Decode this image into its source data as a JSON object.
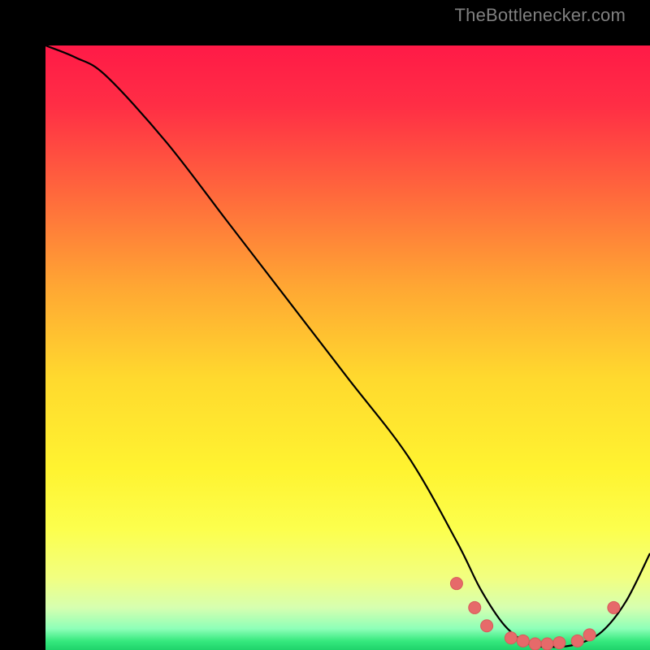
{
  "watermark": "TheBottlenecker.com",
  "colors": {
    "black": "#000000",
    "curve_stroke": "#000000",
    "marker_fill": "#e66a6a",
    "marker_stroke": "#d85a5a"
  },
  "chart_data": {
    "type": "line",
    "title": "",
    "xlabel": "",
    "ylabel": "",
    "xlim": [
      0,
      100
    ],
    "ylim": [
      0,
      100
    ],
    "gradient_stops": [
      {
        "offset": 0.0,
        "color": "#ff1a47"
      },
      {
        "offset": 0.1,
        "color": "#ff2e45"
      },
      {
        "offset": 0.25,
        "color": "#ff6a3c"
      },
      {
        "offset": 0.4,
        "color": "#ffa733"
      },
      {
        "offset": 0.55,
        "color": "#ffd92e"
      },
      {
        "offset": 0.7,
        "color": "#fff330"
      },
      {
        "offset": 0.8,
        "color": "#fcff4d"
      },
      {
        "offset": 0.88,
        "color": "#f2ff80"
      },
      {
        "offset": 0.93,
        "color": "#d6ffb0"
      },
      {
        "offset": 0.965,
        "color": "#8dffb8"
      },
      {
        "offset": 0.985,
        "color": "#36e97e"
      },
      {
        "offset": 1.0,
        "color": "#1fd36b"
      }
    ],
    "series": [
      {
        "name": "bottleneck-curve",
        "x": [
          0,
          5,
          10,
          20,
          30,
          40,
          50,
          60,
          68,
          72,
          76,
          80,
          84,
          88,
          92,
          96,
          100
        ],
        "y": [
          100,
          98,
          95,
          84,
          71,
          58,
          45,
          32,
          18,
          10,
          4,
          1,
          0.5,
          1,
          3,
          8,
          16
        ]
      }
    ],
    "markers": {
      "x": [
        68,
        71,
        73,
        77,
        79,
        81,
        83,
        85,
        88,
        90,
        94
      ],
      "y": [
        11,
        7,
        4,
        2,
        1.5,
        1,
        1,
        1.2,
        1.5,
        2.5,
        7
      ]
    }
  }
}
